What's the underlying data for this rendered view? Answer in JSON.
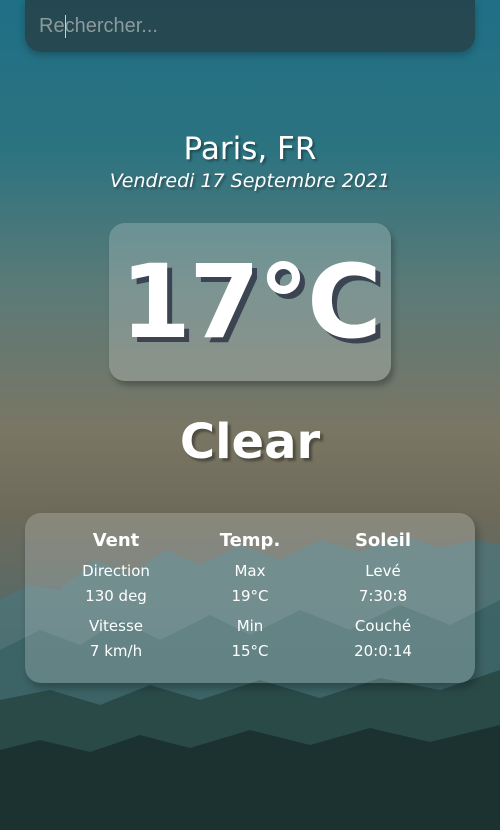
{
  "search": {
    "placeholder": "Rechercher...",
    "value": ""
  },
  "location": {
    "city_country": "Paris, FR",
    "date": "Vendredi 17 Septembre 2021"
  },
  "weather": {
    "temperature": "17°C",
    "condition": "Clear"
  },
  "details": {
    "wind": {
      "title": "Vent",
      "direction_label": "Direction",
      "direction_value": "130 deg",
      "speed_label": "Vitesse",
      "speed_value": "7 km/h"
    },
    "temp": {
      "title": "Temp.",
      "max_label": "Max",
      "max_value": "19°C",
      "min_label": "Min",
      "min_value": "15°C"
    },
    "sun": {
      "title": "Soleil",
      "rise_label": "Levé",
      "rise_value": "7:30:8",
      "set_label": "Couché",
      "set_value": "20:0:14"
    }
  },
  "colors": {
    "sky_top": "#1f6f86",
    "sky_mid": "#7a7664",
    "mountain_dark": "#1d3432",
    "panel_overlay": "rgba(255,255,255,0.2)"
  }
}
